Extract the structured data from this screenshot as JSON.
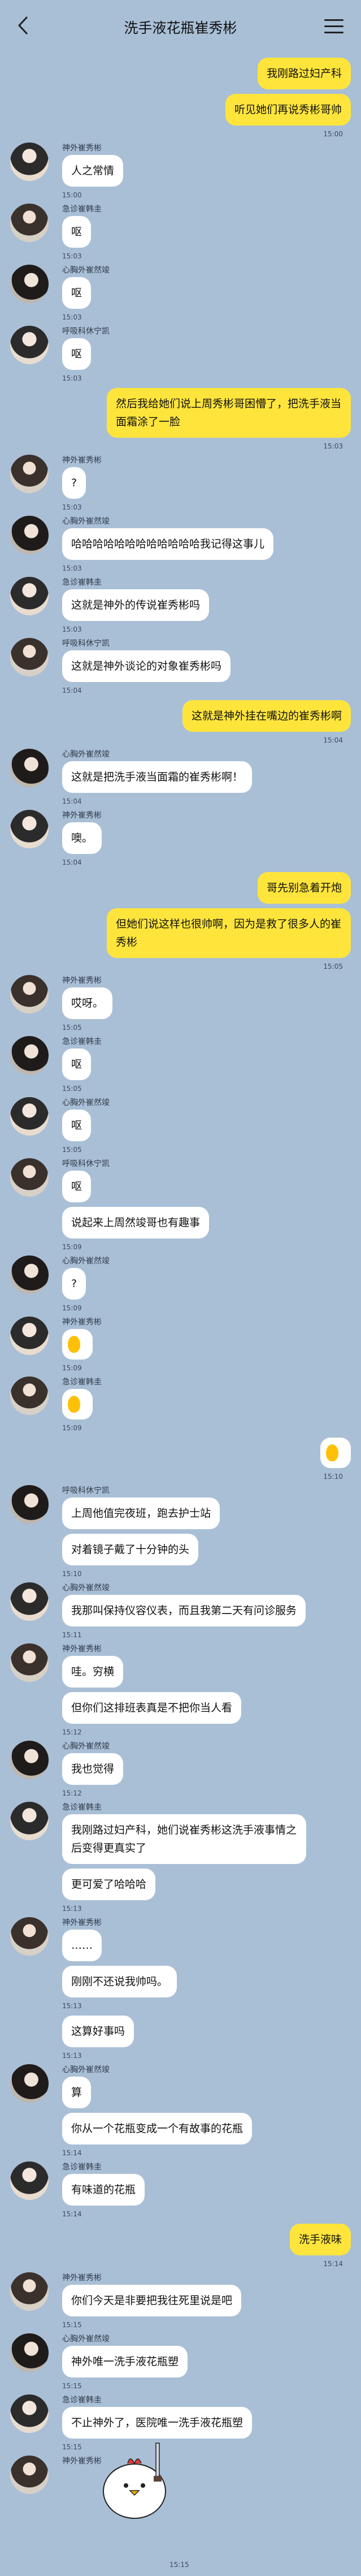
{
  "header": {
    "title": "洗手液花瓶崔秀彬",
    "back_icon": "back-icon",
    "menu_icon": "menu-icon"
  },
  "messages": [
    {
      "side": "right",
      "text": "我刚路过妇产科",
      "time": ""
    },
    {
      "side": "right",
      "text": "听见她们再说秀彬哥帅",
      "time": "15:00"
    },
    {
      "side": "left",
      "sender": "神外崔秀彬",
      "text": "人之常情",
      "time": "15:00",
      "avatar": "g1"
    },
    {
      "side": "left",
      "sender": "急诊崔韩圭",
      "text": "呕",
      "time": "15:03",
      "avatar": "g2"
    },
    {
      "side": "left",
      "sender": "心胸外崔然竣",
      "text": "呕",
      "time": "15:03",
      "avatar": "g3"
    },
    {
      "side": "left",
      "sender": "呼吸科休宁凯",
      "text": "呕",
      "time": "15:03",
      "avatar": "g1"
    },
    {
      "side": "right",
      "text": "然后我给她们说上周秀彬哥困懵了，把洗手液当面霜涂了一脸",
      "time": "15:03"
    },
    {
      "side": "left",
      "sender": "神外崔秀彬",
      "text": "?",
      "time": "15:03",
      "avatar": "g2"
    },
    {
      "side": "left",
      "sender": "心胸外崔然竣",
      "text": "哈哈哈哈哈哈哈哈哈哈哈哈我记得这事儿",
      "time": "15:03",
      "avatar": "g3"
    },
    {
      "side": "left",
      "sender": "急诊崔韩圭",
      "text": "这就是神外的传说崔秀彬吗",
      "time": "15:03",
      "avatar": "g1"
    },
    {
      "side": "left",
      "sender": "呼吸科休宁凯",
      "text": "这就是神外谈论的对象崔秀彬吗",
      "time": "15:04",
      "avatar": "g2"
    },
    {
      "side": "right",
      "text": "这就是神外挂在嘴边的崔秀彬啊",
      "time": "15:04"
    },
    {
      "side": "left",
      "sender": "心胸外崔然竣",
      "text": "这就是把洗手液当面霜的崔秀彬啊！",
      "time": "15:04",
      "avatar": "g3"
    },
    {
      "side": "left",
      "sender": "神外崔秀彬",
      "text": "噢。",
      "time": "15:04",
      "avatar": "g1"
    },
    {
      "side": "right",
      "text": "哥先别急着开炮",
      "time": ""
    },
    {
      "side": "right",
      "text": "但她们说这样也很帅啊，因为是救了很多人的崔秀彬",
      "time": "15:05"
    },
    {
      "side": "left",
      "sender": "神外崔秀彬",
      "text": "哎呀。",
      "time": "15:05",
      "avatar": "g2"
    },
    {
      "side": "left",
      "sender": "急诊崔韩圭",
      "text": "呕",
      "time": "15:05",
      "avatar": "g3"
    },
    {
      "side": "left",
      "sender": "心胸外崔然竣",
      "text": "呕",
      "time": "15:05",
      "avatar": "g1"
    },
    {
      "side": "left",
      "sender": "呼吸科休宁凯",
      "text": "呕",
      "time": "",
      "avatar": "g2"
    },
    {
      "side": "left",
      "sender": "",
      "text": "说起来上周然竣哥也有趣事",
      "time": "15:09",
      "avatar": ""
    },
    {
      "side": "left",
      "sender": "心胸外崔然竣",
      "text": "?",
      "time": "15:09",
      "avatar": "g3"
    },
    {
      "side": "left",
      "sender": "神外崔秀彬",
      "text": "",
      "sticker": true,
      "time": "15:09",
      "avatar": "g1"
    },
    {
      "side": "left",
      "sender": "急诊崔韩圭",
      "text": "",
      "sticker": true,
      "time": "15:09",
      "avatar": "g2"
    },
    {
      "side": "right",
      "text": "",
      "sticker": true,
      "time": "15:10"
    },
    {
      "side": "left",
      "sender": "呼吸科休宁凯",
      "text": "上周他值完夜班，跑去护士站",
      "time": "",
      "avatar": "g3"
    },
    {
      "side": "left",
      "sender": "",
      "text": "对着镜子戴了十分钟的头",
      "time": "15:10",
      "avatar": ""
    },
    {
      "side": "left",
      "sender": "心胸外崔然竣",
      "text": "我那叫保持仪容仪表，而且我第二天有问诊服务",
      "time": "15:11",
      "avatar": "g1"
    },
    {
      "side": "left",
      "sender": "神外崔秀彬",
      "text": "哇。穷横",
      "time": "",
      "avatar": "g2"
    },
    {
      "side": "left",
      "sender": "",
      "text": "但你们这排班表真是不把你当人看",
      "time": "15:12",
      "avatar": ""
    },
    {
      "side": "left",
      "sender": "心胸外崔然竣",
      "text": "我也觉得",
      "time": "15:12",
      "avatar": "g3"
    },
    {
      "side": "left",
      "sender": "急诊崔韩圭",
      "text": "我刚路过妇产科，她们说崔秀彬这洗手液事情之后变得更真实了",
      "time": "",
      "avatar": "g1"
    },
    {
      "side": "left",
      "sender": "",
      "text": "更可爱了哈哈哈",
      "time": "15:13",
      "avatar": ""
    },
    {
      "side": "left",
      "sender": "神外崔秀彬",
      "text": "……",
      "time": "",
      "avatar": "g2"
    },
    {
      "side": "left",
      "sender": "",
      "text": "刚刚不还说我帅吗。",
      "time": "15:13",
      "avatar": ""
    },
    {
      "side": "left",
      "sender": "",
      "text": "这算好事吗",
      "time": "15:13",
      "avatar": ""
    },
    {
      "side": "left",
      "sender": "心胸外崔然竣",
      "text": "算",
      "time": "",
      "avatar": "g3"
    },
    {
      "side": "left",
      "sender": "",
      "text": "你从一个花瓶变成一个有故事的花瓶",
      "time": "15:14",
      "avatar": ""
    },
    {
      "side": "left",
      "sender": "急诊崔韩圭",
      "text": "有味道的花瓶",
      "time": "15:14",
      "avatar": "g1"
    },
    {
      "side": "right",
      "text": "洗手液味",
      "time": "15:14"
    },
    {
      "side": "left",
      "sender": "神外崔秀彬",
      "text": "你们今天是非要把我往死里说是吧",
      "time": "15:15",
      "avatar": "g2"
    },
    {
      "side": "left",
      "sender": "心胸外崔然竣",
      "text": "神外唯一洗手液花瓶塑",
      "time": "15:15",
      "avatar": "g3"
    },
    {
      "side": "left",
      "sender": "急诊崔韩圭",
      "text": "不止神外了，医院唯一洗手液花瓶塑",
      "time": "15:15",
      "avatar": "g1"
    },
    {
      "side": "left",
      "sender": "神外崔秀彬",
      "text": "",
      "sticker_big": true,
      "time": "",
      "avatar": "g2"
    }
  ],
  "last_time": "15:15",
  "mascot_icon": "chicken-with-knife-icon"
}
